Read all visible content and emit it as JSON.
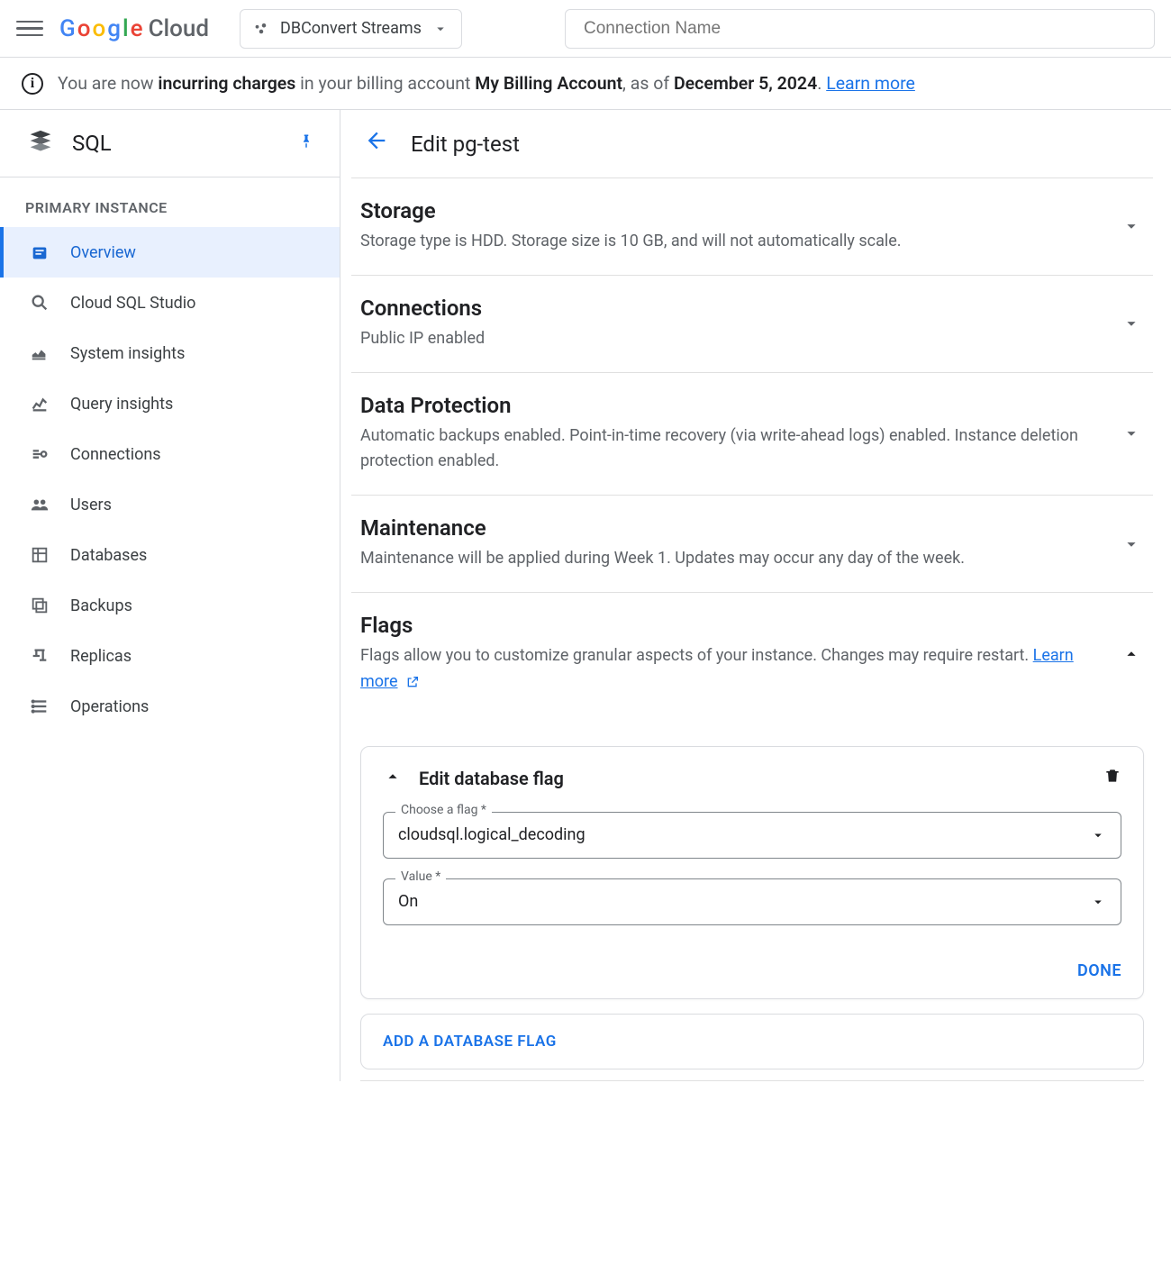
{
  "header": {
    "project_name": "DBConvert Streams",
    "search_placeholder": "Connection Name"
  },
  "notice": {
    "prefix": "You are now ",
    "bold1": "incurring charges",
    "mid1": " in your billing account ",
    "bold2": "My Billing Account",
    "mid2": ", as of ",
    "bold3": "December 5, 2024",
    "suffix": ". ",
    "learn_more": "Learn more"
  },
  "sidebar": {
    "service_title": "SQL",
    "section_label": "PRIMARY INSTANCE",
    "items": [
      {
        "label": "Overview",
        "icon": "overview"
      },
      {
        "label": "Cloud SQL Studio",
        "icon": "search"
      },
      {
        "label": "System insights",
        "icon": "chart"
      },
      {
        "label": "Query insights",
        "icon": "bars"
      },
      {
        "label": "Connections",
        "icon": "conn"
      },
      {
        "label": "Users",
        "icon": "users"
      },
      {
        "label": "Databases",
        "icon": "db"
      },
      {
        "label": "Backups",
        "icon": "backup"
      },
      {
        "label": "Replicas",
        "icon": "replica"
      },
      {
        "label": "Operations",
        "icon": "ops"
      }
    ]
  },
  "page": {
    "title": "Edit pg-test",
    "sections": {
      "storage": {
        "title": "Storage",
        "desc": "Storage type is HDD. Storage size is 10 GB, and will not automatically scale."
      },
      "connections": {
        "title": "Connections",
        "desc": "Public IP enabled"
      },
      "data_protection": {
        "title": "Data Protection",
        "desc": "Automatic backups enabled. Point-in-time recovery (via write-ahead logs) enabled. Instance deletion protection enabled."
      },
      "maintenance": {
        "title": "Maintenance",
        "desc": "Maintenance will be applied during Week 1. Updates may occur any day of the week."
      },
      "flags": {
        "title": "Flags",
        "desc_prefix": "Flags allow you to customize granular aspects of your instance. Changes may require restart. ",
        "learn_more": "Learn more"
      }
    },
    "flag_card": {
      "title": "Edit database flag",
      "choose_label": "Choose a flag *",
      "choose_value": "cloudsql.logical_decoding",
      "value_label": "Value *",
      "value_value": "On",
      "done": "DONE"
    },
    "add_flag": "ADD A DATABASE FLAG"
  }
}
